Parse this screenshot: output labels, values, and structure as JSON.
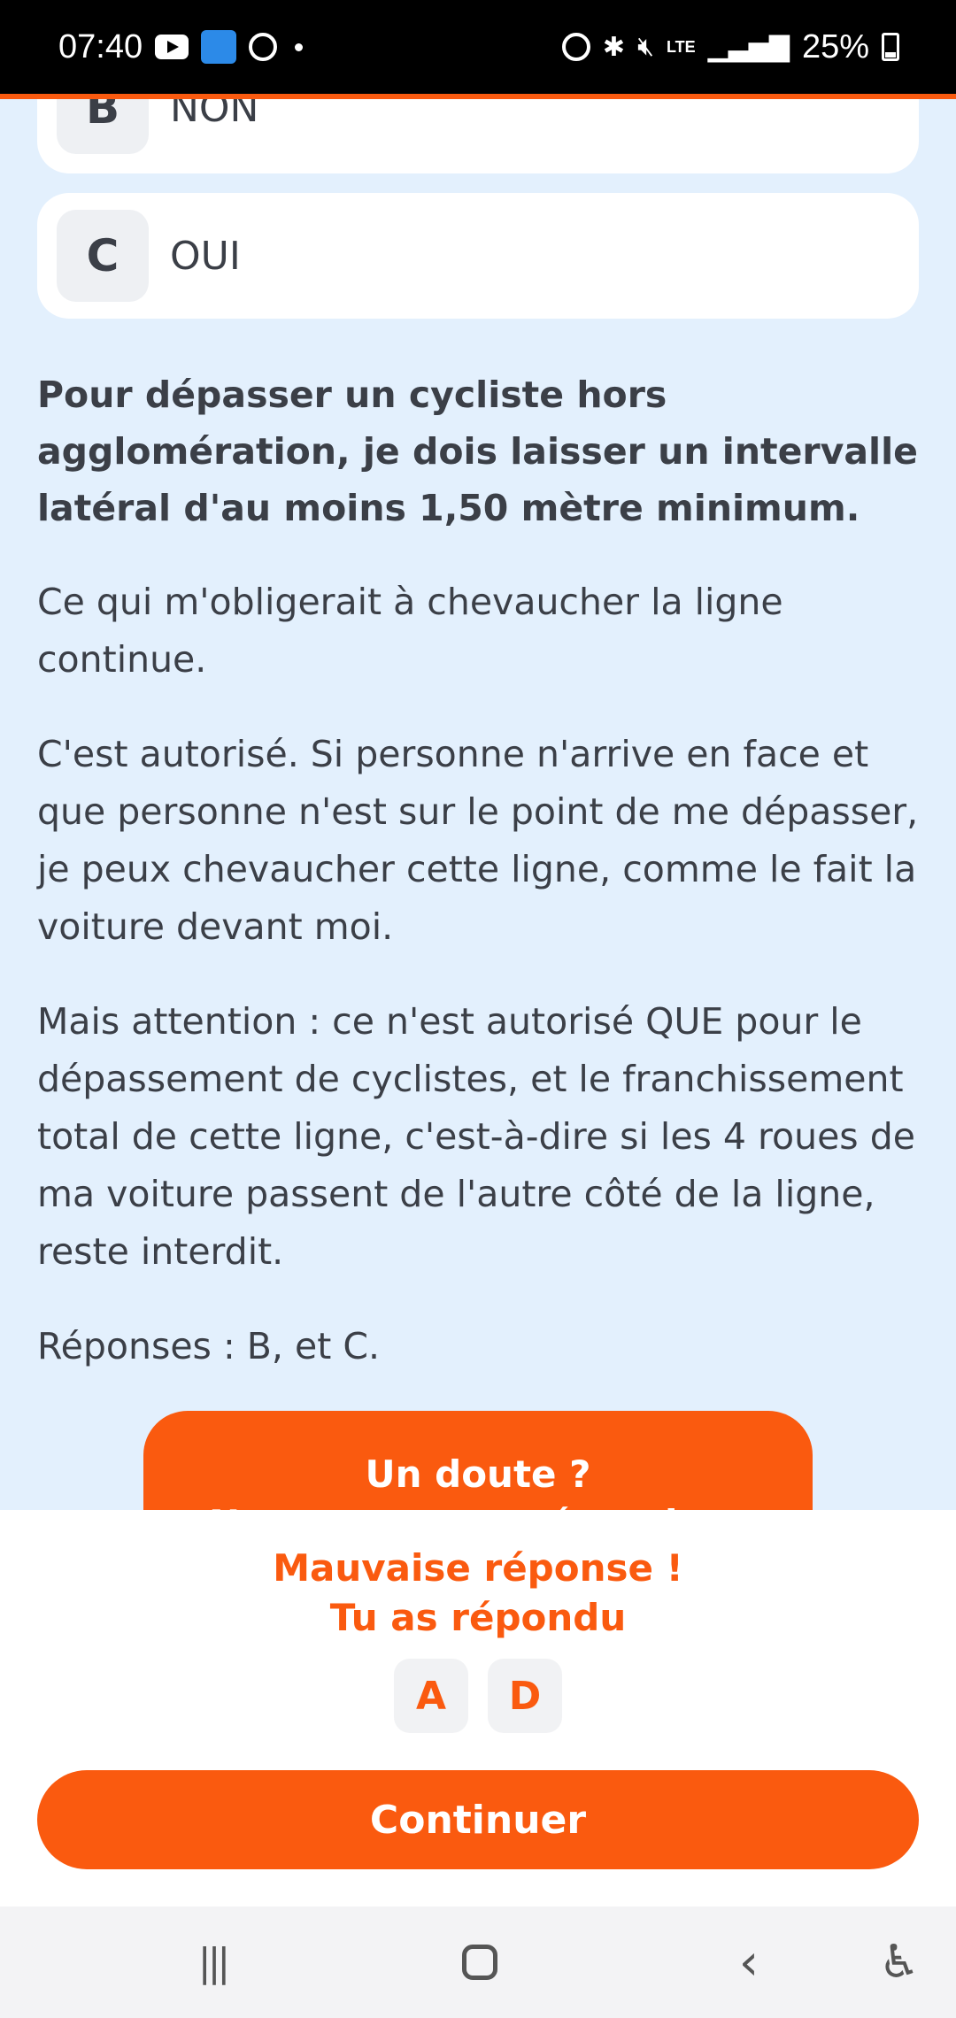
{
  "status_bar": {
    "time": "07:40",
    "battery_pct": "25%",
    "icons": [
      "youtube-icon",
      "app-icon",
      "alarm-icon",
      "notification-dot-icon",
      "alarm-icon",
      "bluetooth-icon",
      "mute-icon",
      "lte-icon",
      "signal-icon",
      "battery-icon"
    ],
    "lte": "LTE",
    "accent": "#fa5a0f"
  },
  "answers": [
    {
      "letter": "B",
      "text": "NON"
    },
    {
      "letter": "C",
      "text": "OUI"
    }
  ],
  "explanation": {
    "bold": "Pour dépasser un cycliste hors agglomération, je dois laisser un intervalle latéral d'au moins 1,50 mètre minimum.",
    "paragraphs": [
      "Ce qui m'obligerait à chevaucher la ligne continue.",
      "C'est autorisé. Si personne n'arrive en face et que personne n'est sur le point de me dépasser, je peux chevaucher cette ligne, comme le fait la voiture devant moi.",
      "Mais attention : ce n'est autorisé QUE pour le dépassement de cyclistes, et le franchissement total de cette ligne, c'est-à-dire si les 4 roues de ma voiture passent de l'autre côté de la ligne, reste interdit.",
      "Réponses : B, et C."
    ]
  },
  "doubt_button": {
    "line1": "Un doute ?",
    "line2": "Nos experts te répondent"
  },
  "feedback": {
    "line1": "Mauvaise réponse !",
    "line2": "Tu as répondu",
    "chosen": [
      "A",
      "D"
    ],
    "continue_label": "Continuer"
  },
  "colors": {
    "background": "#e3f0fd",
    "orange": "#fa5a0f",
    "text": "#3b3f47"
  }
}
